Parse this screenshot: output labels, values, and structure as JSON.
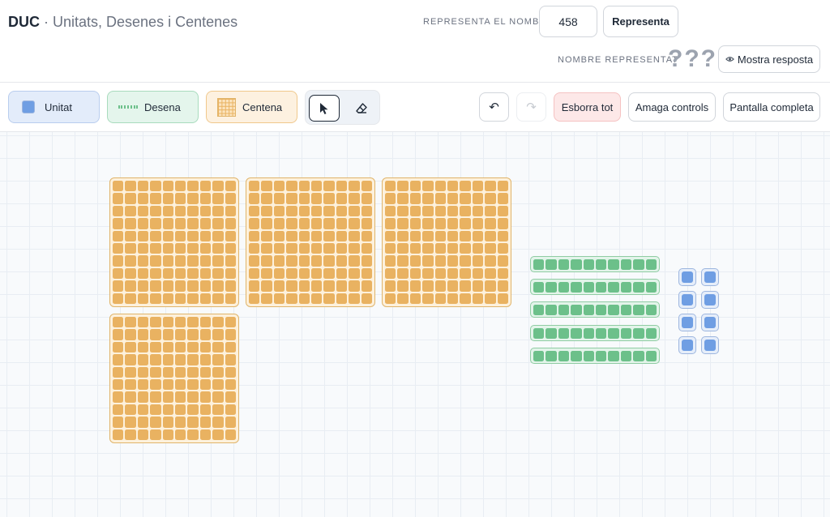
{
  "app": {
    "abbr": "DUC",
    "separator": " · ",
    "title": "Unitats, Desenes i Centenes"
  },
  "represent": {
    "label": "REPRESENTA EL NOMBRE",
    "value": "458",
    "button": "Representa"
  },
  "represented": {
    "label": "NOMBRE REPRESENTAT",
    "value": "???",
    "button": "Mostra resposta"
  },
  "pieces": {
    "unit": "Unitat",
    "ten": "Desena",
    "hundred": "Centena"
  },
  "tools": {
    "select": "pointer-icon",
    "erase": "eraser-icon"
  },
  "actions": {
    "undo": "↶",
    "redo": "↷",
    "clear": "Esborra tot",
    "hide": "Amaga controls",
    "fullscreen": "Pantalla completa"
  },
  "board": {
    "hundreds": 4,
    "tens": 5,
    "units": 8
  },
  "colors": {
    "unit": "#6f9ee3",
    "ten": "#6cc08a",
    "hundred": "#e9b261",
    "clear_bg": "#fde8e8"
  }
}
